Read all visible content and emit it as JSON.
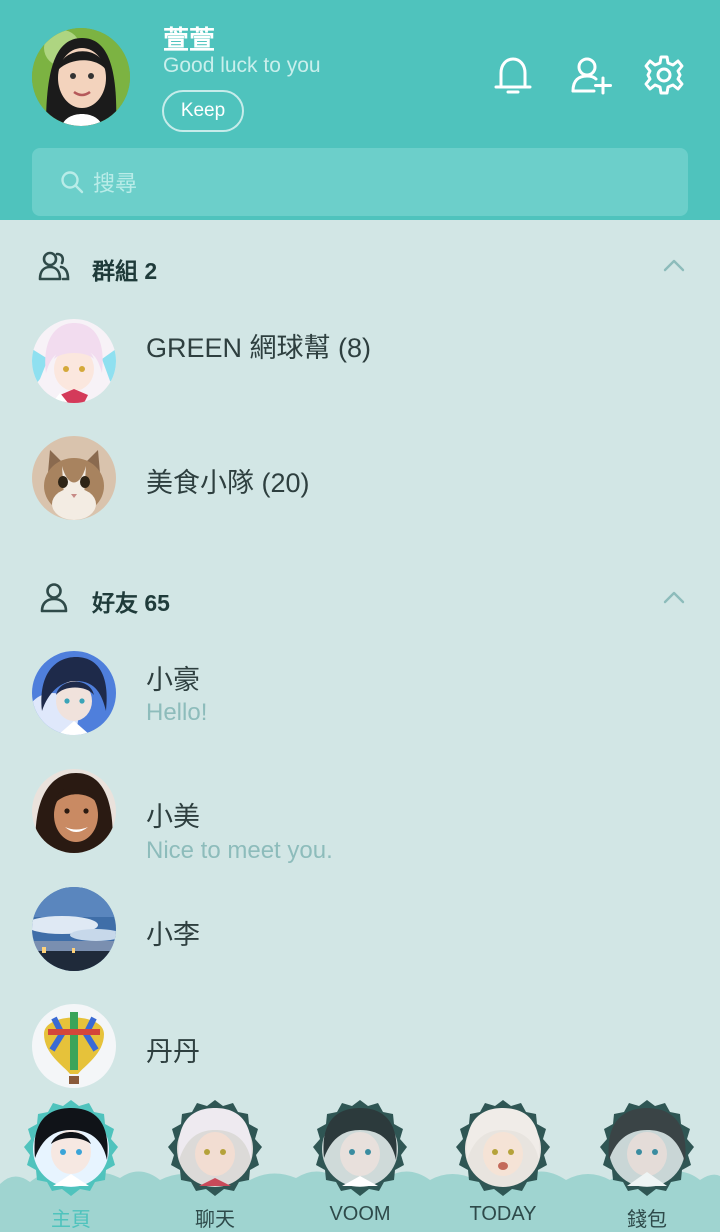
{
  "header": {
    "user_name": "萱萱",
    "user_status": "Good luck to you",
    "keep_label": "Keep",
    "icons": [
      "bell-icon",
      "add-friend-icon",
      "settings-icon"
    ]
  },
  "search": {
    "placeholder": "搜尋"
  },
  "groups_section": {
    "title": "群組 2",
    "items": [
      {
        "name": "GREEN 網球幫 (8)",
        "avatar": "anime-white-hair"
      },
      {
        "name": "美食小隊 (20)",
        "avatar": "cat"
      }
    ]
  },
  "friends_section": {
    "title": "好友 65",
    "items": [
      {
        "name": "小豪",
        "message": "Hello!",
        "avatar": "anime-dark-hair"
      },
      {
        "name": "小美",
        "message": "Nice to meet you.",
        "avatar": "woman-photo"
      },
      {
        "name": "小李",
        "message": "",
        "avatar": "sky-photo"
      },
      {
        "name": "丹丹",
        "message": "",
        "avatar": "balloon-photo"
      }
    ]
  },
  "tabbar": {
    "tabs": [
      {
        "label": "主頁",
        "active": true
      },
      {
        "label": "聊天",
        "active": false
      },
      {
        "label": "VOOM",
        "active": false
      },
      {
        "label": "TODAY",
        "active": false
      },
      {
        "label": "錢包",
        "active": false
      }
    ]
  },
  "colors": {
    "accent": "#4fc3bd",
    "background": "#d2e6e5",
    "text": "#2e3f3f",
    "muted": "#8dbcbb"
  }
}
